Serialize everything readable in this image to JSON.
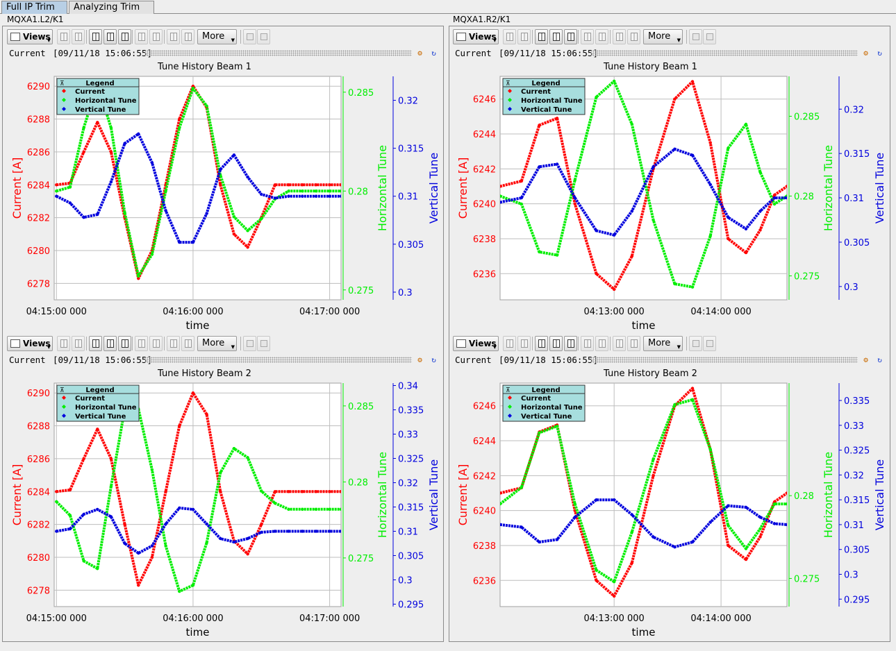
{
  "tabs": [
    {
      "label": "Full IP Trim",
      "active": true
    },
    {
      "label": "Analyzing Trim",
      "active": false
    }
  ],
  "columns": [
    {
      "title": "MQXA1.L2/K1"
    },
    {
      "title": "MQXA1.R2/K1"
    }
  ],
  "toolbar": {
    "views_label": "Views",
    "more_label": "More"
  },
  "panel_header": {
    "mode_label": "Current",
    "timestamp": "[09/11/18 15:06:55]"
  },
  "legend": {
    "title": "Legend",
    "entries": [
      "Current",
      "Horizontal Tune",
      "Vertical Tune"
    ]
  },
  "colors": {
    "current": "#ff0000",
    "horizontal": "#00ee00",
    "vertical": "#0000dd",
    "grid": "#bdbdbd"
  },
  "chart_data": [
    {
      "type": "scatter",
      "title": "Tune History Beam 1",
      "xlabel": "time",
      "x_ticks": [
        "04:15:00 000",
        "04:16:00 000",
        "04:17:00 000"
      ],
      "x_tick_seconds": [
        0,
        60,
        120
      ],
      "xlim": [
        -1,
        125
      ],
      "y_left": {
        "label": "Current [A]",
        "ticks": [
          6278,
          6280,
          6282,
          6284,
          6286,
          6288,
          6290
        ],
        "lim": [
          6277,
          6290.6
        ]
      },
      "y_mid": {
        "label": "Horizontal Tune",
        "ticks": [
          0.275,
          0.28,
          0.285
        ],
        "lim": [
          0.2745,
          0.2858
        ]
      },
      "y_right": {
        "label": "Vertical Tune",
        "ticks": [
          0.3,
          0.305,
          0.31,
          0.315,
          0.32
        ],
        "lim": [
          0.2992,
          0.3225
        ]
      },
      "series": [
        {
          "name": "Current",
          "x": [
            0,
            6,
            12,
            18,
            24,
            30,
            36,
            42,
            48,
            54,
            60,
            66,
            72,
            78,
            84,
            90,
            96,
            102,
            108,
            114,
            120,
            125
          ],
          "y": [
            6284,
            6284.1,
            6286,
            6287.8,
            6286,
            6282,
            6278.3,
            6280,
            6284,
            6288,
            6290,
            6288.7,
            6284,
            6281,
            6280.2,
            6282,
            6284,
            6284,
            6284,
            6284,
            6284,
            6284
          ]
        },
        {
          "name": "Horizontal Tune",
          "x": [
            0,
            6,
            12,
            18,
            24,
            30,
            36,
            42,
            48,
            54,
            60,
            66,
            72,
            78,
            84,
            90,
            96,
            102,
            108,
            114,
            120,
            125
          ],
          "y": [
            0.28,
            0.2802,
            0.2832,
            0.2854,
            0.2832,
            0.2789,
            0.2757,
            0.2768,
            0.28,
            0.2832,
            0.2852,
            0.2843,
            0.2808,
            0.2787,
            0.278,
            0.2786,
            0.2796,
            0.28,
            0.28,
            0.28,
            0.28,
            0.28
          ]
        },
        {
          "name": "Vertical Tune",
          "x": [
            0,
            6,
            12,
            18,
            24,
            30,
            36,
            42,
            48,
            54,
            60,
            66,
            72,
            78,
            84,
            90,
            96,
            102,
            108,
            114,
            120,
            125
          ],
          "y": [
            0.31,
            0.3093,
            0.3078,
            0.3081,
            0.3115,
            0.3155,
            0.3165,
            0.3135,
            0.3085,
            0.3052,
            0.3052,
            0.3082,
            0.3128,
            0.3143,
            0.312,
            0.3102,
            0.3098,
            0.31,
            0.31,
            0.31,
            0.31,
            0.31
          ]
        }
      ]
    },
    {
      "type": "scatter",
      "title": "Tune History Beam 1",
      "xlabel": "time",
      "x_ticks": [
        "04:13:00 000",
        "04:14:00 000"
      ],
      "x_tick_seconds": [
        0,
        60
      ],
      "xlim": [
        -64,
        97
      ],
      "y_left": {
        "label": "Current [A]",
        "ticks": [
          6236,
          6238,
          6240,
          6242,
          6244,
          6246
        ],
        "lim": [
          6234.5,
          6247.3
        ]
      },
      "y_mid": {
        "label": "Horizontal Tune",
        "ticks": [
          0.275,
          0.28,
          0.285
        ],
        "lim": [
          0.2735,
          0.2875
        ]
      },
      "y_right": {
        "label": "Vertical Tune",
        "ticks": [
          0.3,
          0.305,
          0.31,
          0.315,
          0.32
        ],
        "lim": [
          0.2985,
          0.3237
        ]
      },
      "series": [
        {
          "name": "Current",
          "x": [
            -64,
            -52,
            -42,
            -32,
            -22,
            -10,
            0,
            10,
            22,
            34,
            44,
            54,
            64,
            74,
            82,
            90,
            97
          ],
          "y": [
            6241,
            6241.3,
            6244.5,
            6244.9,
            6240,
            6236,
            6235.1,
            6237,
            6242,
            6246,
            6247,
            6243.5,
            6238,
            6237.2,
            6238.5,
            6240.5,
            6241
          ]
        },
        {
          "name": "Horizontal Tune",
          "x": [
            -64,
            -52,
            -42,
            -32,
            -22,
            -10,
            0,
            10,
            22,
            34,
            44,
            54,
            64,
            74,
            82,
            90,
            97
          ],
          "y": [
            0.28,
            0.2795,
            0.2765,
            0.2763,
            0.281,
            0.2862,
            0.2872,
            0.2845,
            0.2785,
            0.2745,
            0.2743,
            0.2775,
            0.283,
            0.2845,
            0.2815,
            0.2795,
            0.28
          ]
        },
        {
          "name": "Vertical Tune",
          "x": [
            -64,
            -52,
            -42,
            -32,
            -22,
            -10,
            0,
            10,
            22,
            34,
            44,
            54,
            64,
            74,
            82,
            90,
            97
          ],
          "y": [
            0.3095,
            0.31,
            0.3135,
            0.3138,
            0.31,
            0.3063,
            0.3058,
            0.3085,
            0.3135,
            0.3155,
            0.3148,
            0.3115,
            0.3078,
            0.3065,
            0.3085,
            0.31,
            0.31
          ]
        }
      ]
    },
    {
      "type": "scatter",
      "title": "Tune History Beam 2",
      "xlabel": "time",
      "x_ticks": [
        "04:15:00 000",
        "04:16:00 000",
        "04:17:00 000"
      ],
      "x_tick_seconds": [
        0,
        60,
        120
      ],
      "xlim": [
        -1,
        125
      ],
      "y_left": {
        "label": "Current [A]",
        "ticks": [
          6278,
          6280,
          6282,
          6284,
          6286,
          6288,
          6290
        ],
        "lim": [
          6277,
          6290.6
        ]
      },
      "y_mid": {
        "label": "Horizontal Tune",
        "ticks": [
          0.275,
          0.28,
          0.285
        ],
        "lim": [
          0.2718,
          0.2865
        ]
      },
      "y_right": {
        "label": "Vertical Tune",
        "ticks": [
          0.295,
          0.3,
          0.305,
          0.31,
          0.315,
          0.32,
          0.325,
          0.33,
          0.335,
          0.34
        ],
        "lim": [
          0.2945,
          0.3405
        ]
      },
      "series": [
        {
          "name": "Current",
          "x": [
            0,
            6,
            12,
            18,
            24,
            30,
            36,
            42,
            48,
            54,
            60,
            66,
            72,
            78,
            84,
            90,
            96,
            102,
            108,
            114,
            120,
            125
          ],
          "y": [
            6284,
            6284.1,
            6286,
            6287.8,
            6286,
            6282,
            6278.3,
            6280,
            6284,
            6288,
            6290,
            6288.7,
            6284,
            6281,
            6280.2,
            6282,
            6284,
            6284,
            6284,
            6284,
            6284,
            6284
          ]
        },
        {
          "name": "Horizontal Tune",
          "x": [
            0,
            6,
            12,
            18,
            24,
            30,
            36,
            42,
            48,
            54,
            60,
            66,
            72,
            78,
            84,
            90,
            96,
            102,
            108,
            114,
            120,
            125
          ],
          "y": [
            0.2787,
            0.2778,
            0.2748,
            0.2743,
            0.2797,
            0.2848,
            0.2848,
            0.2808,
            0.2758,
            0.2728,
            0.2732,
            0.276,
            0.2806,
            0.2822,
            0.2816,
            0.2794,
            0.2786,
            0.2782,
            0.2782,
            0.2782,
            0.2782,
            0.2782
          ]
        },
        {
          "name": "Vertical Tune",
          "x": [
            0,
            6,
            12,
            18,
            24,
            30,
            36,
            42,
            48,
            54,
            60,
            66,
            72,
            78,
            84,
            90,
            96,
            102,
            108,
            114,
            120,
            125
          ],
          "y": [
            0.31,
            0.3105,
            0.3135,
            0.3145,
            0.313,
            0.3075,
            0.3055,
            0.307,
            0.3115,
            0.3148,
            0.3145,
            0.3115,
            0.3085,
            0.3078,
            0.3085,
            0.3098,
            0.31,
            0.31,
            0.31,
            0.31,
            0.31,
            0.31
          ]
        }
      ]
    },
    {
      "type": "scatter",
      "title": "Tune History Beam 2",
      "xlabel": "time",
      "x_ticks": [
        "04:13:00 000",
        "04:14:00 000"
      ],
      "x_tick_seconds": [
        0,
        60
      ],
      "xlim": [
        -64,
        97
      ],
      "y_left": {
        "label": "Current [A]",
        "ticks": [
          6236,
          6238,
          6240,
          6242,
          6244,
          6246
        ],
        "lim": [
          6234.5,
          6247.3
        ]
      },
      "y_mid": {
        "label": "Horizontal Tune",
        "ticks": [
          0.275,
          0.28
        ],
        "lim": [
          0.2733,
          0.2868
        ]
      },
      "y_right": {
        "label": "Vertical Tune",
        "ticks": [
          0.295,
          0.3,
          0.305,
          0.31,
          0.315,
          0.32,
          0.325,
          0.33,
          0.335
        ],
        "lim": [
          0.2935,
          0.3385
        ]
      },
      "series": [
        {
          "name": "Current",
          "x": [
            -64,
            -52,
            -42,
            -32,
            -22,
            -10,
            0,
            10,
            22,
            34,
            44,
            54,
            64,
            74,
            82,
            90,
            97
          ],
          "y": [
            6241,
            6241.3,
            6244.5,
            6244.9,
            6240,
            6236,
            6235.1,
            6237,
            6242,
            6246,
            6247,
            6243.5,
            6238,
            6237.2,
            6238.5,
            6240.5,
            6241
          ]
        },
        {
          "name": "Horizontal Tune",
          "x": [
            -64,
            -52,
            -42,
            -32,
            -22,
            -10,
            0,
            10,
            22,
            34,
            44,
            54,
            64,
            74,
            82,
            90,
            97
          ],
          "y": [
            0.2795,
            0.2805,
            0.2838,
            0.2842,
            0.2795,
            0.2755,
            0.2748,
            0.2778,
            0.2822,
            0.2855,
            0.2858,
            0.2828,
            0.2782,
            0.2768,
            0.278,
            0.2795,
            0.2795
          ]
        },
        {
          "name": "Vertical Tune",
          "x": [
            -64,
            -52,
            -42,
            -32,
            -22,
            -10,
            0,
            10,
            22,
            34,
            44,
            54,
            64,
            74,
            82,
            90,
            97
          ],
          "y": [
            0.31,
            0.3095,
            0.3065,
            0.307,
            0.3115,
            0.315,
            0.315,
            0.312,
            0.3075,
            0.3055,
            0.3065,
            0.3105,
            0.3138,
            0.3135,
            0.3115,
            0.3102,
            0.31
          ]
        }
      ]
    }
  ]
}
